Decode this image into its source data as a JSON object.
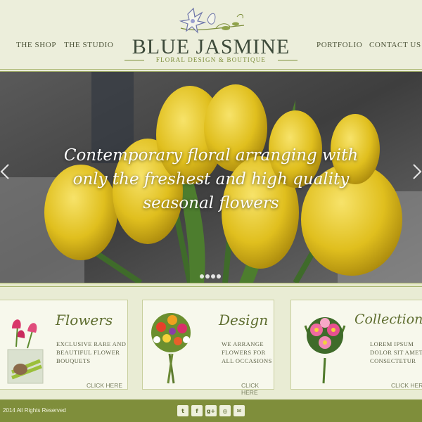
{
  "nav": {
    "left": [
      "THE SHOP",
      "THE STUDIO"
    ],
    "right": [
      "PORTFOLIO",
      "CONTACT US"
    ]
  },
  "logo": {
    "title": "BLUE JASMINE",
    "subtitle": "FLORAL DESIGN & BOUTIQUE"
  },
  "hero": {
    "lines": [
      "Contemporary floral arranging with",
      "only the freshest and high quality",
      "seasonal flowers"
    ],
    "slide_count": 4,
    "active_slide": 1
  },
  "cards": [
    {
      "title": "Flowers",
      "desc": "EXCLUSIVE RARE AND BEAUTIFUL FLOWER BOUQUETS",
      "link": "CLICK HERE",
      "icon": "calla-lily-arrangement"
    },
    {
      "title": "Design",
      "desc": "WE ARRANGE FLOWERS FOR ALL OCCASIONS",
      "link": "CLICK HERE",
      "icon": "mixed-bouquet"
    },
    {
      "title": "Collections",
      "desc": "LOREM IPSUM DOLOR SIT AMETU CONSECTETUR",
      "link": "CLICK HERE",
      "icon": "pink-gerbera-bouquet"
    }
  ],
  "footer": {
    "copyright": "2014 All Rights Reserved",
    "social": [
      {
        "icon": "twitter-icon",
        "glyph": "t"
      },
      {
        "icon": "facebook-icon",
        "glyph": "f"
      },
      {
        "icon": "google-plus-icon",
        "glyph": "g+"
      },
      {
        "icon": "instagram-icon",
        "glyph": "◎"
      },
      {
        "icon": "email-icon",
        "glyph": "✉"
      }
    ]
  },
  "colors": {
    "background": "#eef0d9",
    "accent_green": "#7f8e3b",
    "logo_text": "#3d4a3a",
    "card_bg": "#f7f8ec"
  }
}
